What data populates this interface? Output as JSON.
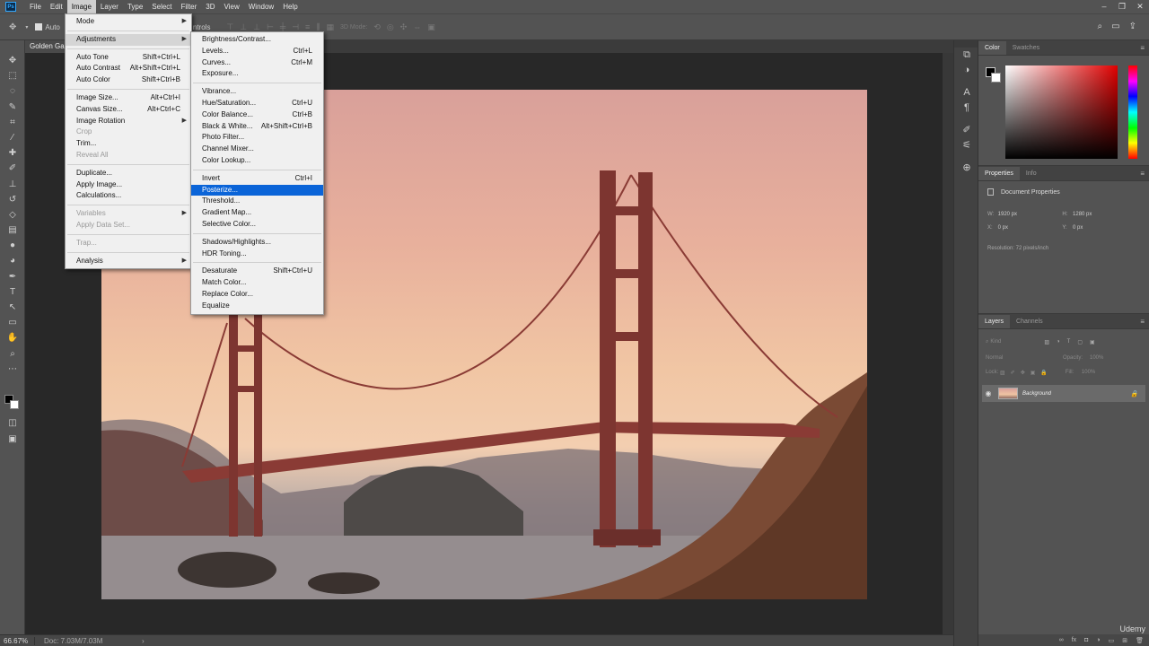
{
  "menubar": {
    "items": [
      "File",
      "Edit",
      "Image",
      "Layer",
      "Type",
      "Select",
      "Filter",
      "3D",
      "View",
      "Window",
      "Help"
    ],
    "active": "Image",
    "logo": "Ps"
  },
  "optionsbar": {
    "partial_label_left": "Auto",
    "partial_label_right": "ntrols",
    "mode_label": "3D Mode:"
  },
  "document": {
    "tab_title": "Golden Ga"
  },
  "image_menu": {
    "items": [
      {
        "label": "Mode",
        "shortcut": "",
        "submenu": true,
        "disabled": false
      },
      {
        "sep": true
      },
      {
        "label": "Adjustments",
        "shortcut": "",
        "submenu": true,
        "highlighted": true
      },
      {
        "sep": true
      },
      {
        "label": "Auto Tone",
        "shortcut": "Shift+Ctrl+L"
      },
      {
        "label": "Auto Contrast",
        "shortcut": "Alt+Shift+Ctrl+L"
      },
      {
        "label": "Auto Color",
        "shortcut": "Shift+Ctrl+B"
      },
      {
        "sep": true
      },
      {
        "label": "Image Size...",
        "shortcut": "Alt+Ctrl+I"
      },
      {
        "label": "Canvas Size...",
        "shortcut": "Alt+Ctrl+C"
      },
      {
        "label": "Image Rotation",
        "shortcut": "",
        "submenu": true
      },
      {
        "label": "Crop",
        "shortcut": "",
        "disabled": true
      },
      {
        "label": "Trim...",
        "shortcut": ""
      },
      {
        "label": "Reveal All",
        "shortcut": "",
        "disabled": true
      },
      {
        "sep": true
      },
      {
        "label": "Duplicate...",
        "shortcut": ""
      },
      {
        "label": "Apply Image...",
        "shortcut": ""
      },
      {
        "label": "Calculations...",
        "shortcut": ""
      },
      {
        "sep": true
      },
      {
        "label": "Variables",
        "shortcut": "",
        "submenu": true,
        "disabled": true
      },
      {
        "label": "Apply Data Set...",
        "shortcut": "",
        "disabled": true
      },
      {
        "sep": true
      },
      {
        "label": "Trap...",
        "shortcut": "",
        "disabled": true
      },
      {
        "sep": true
      },
      {
        "label": "Analysis",
        "shortcut": "",
        "submenu": true
      }
    ]
  },
  "adjustments_menu": {
    "items": [
      {
        "label": "Brightness/Contrast...",
        "shortcut": ""
      },
      {
        "label": "Levels...",
        "shortcut": "Ctrl+L"
      },
      {
        "label": "Curves...",
        "shortcut": "Ctrl+M"
      },
      {
        "label": "Exposure...",
        "shortcut": ""
      },
      {
        "sep": true
      },
      {
        "label": "Vibrance...",
        "shortcut": ""
      },
      {
        "label": "Hue/Saturation...",
        "shortcut": "Ctrl+U"
      },
      {
        "label": "Color Balance...",
        "shortcut": "Ctrl+B"
      },
      {
        "label": "Black & White...",
        "shortcut": "Alt+Shift+Ctrl+B"
      },
      {
        "label": "Photo Filter...",
        "shortcut": ""
      },
      {
        "label": "Channel Mixer...",
        "shortcut": ""
      },
      {
        "label": "Color Lookup...",
        "shortcut": ""
      },
      {
        "sep": true
      },
      {
        "label": "Invert",
        "shortcut": "Ctrl+I"
      },
      {
        "label": "Posterize...",
        "shortcut": "",
        "selected": true
      },
      {
        "label": "Threshold...",
        "shortcut": ""
      },
      {
        "label": "Gradient Map...",
        "shortcut": ""
      },
      {
        "label": "Selective Color...",
        "shortcut": ""
      },
      {
        "sep": true
      },
      {
        "label": "Shadows/Highlights...",
        "shortcut": ""
      },
      {
        "label": "HDR Toning...",
        "shortcut": ""
      },
      {
        "sep": true
      },
      {
        "label": "Desaturate",
        "shortcut": "Shift+Ctrl+U"
      },
      {
        "label": "Match Color...",
        "shortcut": ""
      },
      {
        "label": "Replace Color...",
        "shortcut": ""
      },
      {
        "label": "Equalize",
        "shortcut": ""
      }
    ]
  },
  "color_panel": {
    "tabs": [
      "Color",
      "Swatches"
    ],
    "foreground": "#000000",
    "background": "#ffffff",
    "hue": "#e00000"
  },
  "properties_panel": {
    "tabs": [
      "Properties",
      "Info"
    ],
    "title": "Document Properties",
    "w_label": "W:",
    "w_value": "1920 px",
    "h_label": "H:",
    "h_value": "1280 px",
    "x_label": "X:",
    "x_value": "0 px",
    "y_label": "Y:",
    "y_value": "0 px",
    "resolution": "Resolution: 72 pixels/inch"
  },
  "layers_panel": {
    "tabs": [
      "Layers",
      "Channels"
    ],
    "filter_placeholder": "Kind",
    "blend_mode": "Normal",
    "opacity_label": "Opacity:",
    "opacity_value": "100%",
    "lock_label": "Lock:",
    "fill_label": "Fill:",
    "fill_value": "100%",
    "layers": [
      {
        "name": "Background",
        "visible": true,
        "locked": true
      }
    ]
  },
  "statusbar": {
    "zoom": "66.67%",
    "doc_size": "Doc: 7.03M/7.03M"
  },
  "watermark": "Udemy",
  "colors": {
    "menu_selection": "#0a64d8",
    "ui_dark": "#535353",
    "bridge_red": "#8a3b35"
  }
}
